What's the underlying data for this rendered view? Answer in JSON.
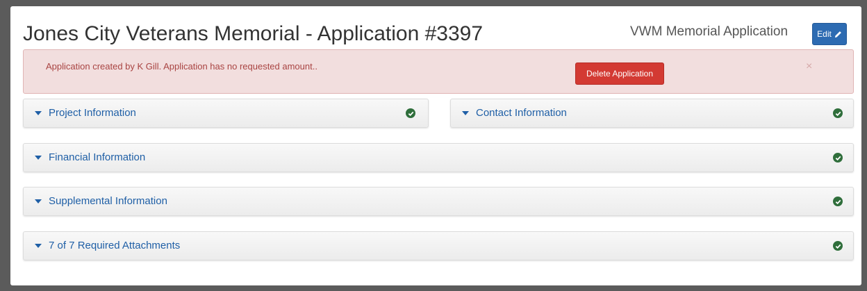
{
  "header": {
    "title": "Jones City Veterans Memorial - Application #3397",
    "form_name": "VWM Memorial Application",
    "edit_label": "Edit"
  },
  "alert": {
    "message": "Application created by K Gill. Application has no requested amount..",
    "delete_label": "Delete Application",
    "close_glyph": "×"
  },
  "sections": [
    {
      "label": "Project Information",
      "status": "complete",
      "icon": "check-circle-icon"
    },
    {
      "label": "Contact Information",
      "status": "complete",
      "icon": "check-circle-icon"
    },
    {
      "label": "Financial Information",
      "status": "complete",
      "icon": "check-circle-icon"
    },
    {
      "label": "Supplemental Information",
      "status": "complete",
      "icon": "check-circle-icon"
    },
    {
      "label": "7 of 7 Required Attachments",
      "status": "complete",
      "icon": "check-circle-icon"
    }
  ],
  "colors": {
    "accent": "#1f5fa6",
    "alert_bg": "#f2dede",
    "alert_text": "#a94442",
    "danger": "#d33a33",
    "success": "#2f6e3b"
  }
}
